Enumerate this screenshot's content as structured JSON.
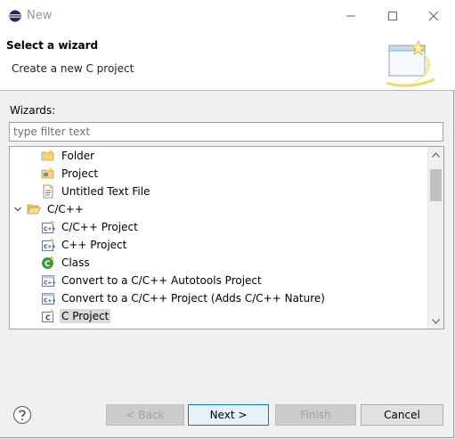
{
  "window": {
    "title": "New"
  },
  "banner": {
    "title": "Select a wizard",
    "description": "Create a new C project"
  },
  "wizards": {
    "label": "Wizards:",
    "filter_placeholder": "type filter text"
  },
  "tree": {
    "items": [
      {
        "label": "Folder",
        "icon": "folder-new-icon",
        "indent": 1
      },
      {
        "label": "Project",
        "icon": "project-icon",
        "indent": 1
      },
      {
        "label": "Untitled Text File",
        "icon": "text-file-icon",
        "indent": 1
      },
      {
        "label": "C/C++",
        "icon": "open-folder-icon",
        "indent": 0,
        "expanded": true
      },
      {
        "label": "C/C++ Project",
        "icon": "cpp-project-icon",
        "indent": 1
      },
      {
        "label": "C++ Project",
        "icon": "cpp-project-icon",
        "indent": 1
      },
      {
        "label": "Class",
        "icon": "class-icon",
        "indent": 1
      },
      {
        "label": "Convert to a C/C++ Autotools Project",
        "icon": "convert-icon",
        "indent": 1
      },
      {
        "label": "Convert to a C/C++ Project (Adds C/C++ Nature)",
        "icon": "convert-icon",
        "indent": 1
      },
      {
        "label": "C Project",
        "icon": "c-project-icon",
        "indent": 1,
        "selected": true
      }
    ]
  },
  "buttons": {
    "back": "< Back",
    "next": "Next >",
    "finish": "Finish",
    "cancel": "Cancel"
  },
  "colors": {
    "title_text": "#999999",
    "selection": "#d9d9d9",
    "default_button_border": "#0078d7"
  }
}
